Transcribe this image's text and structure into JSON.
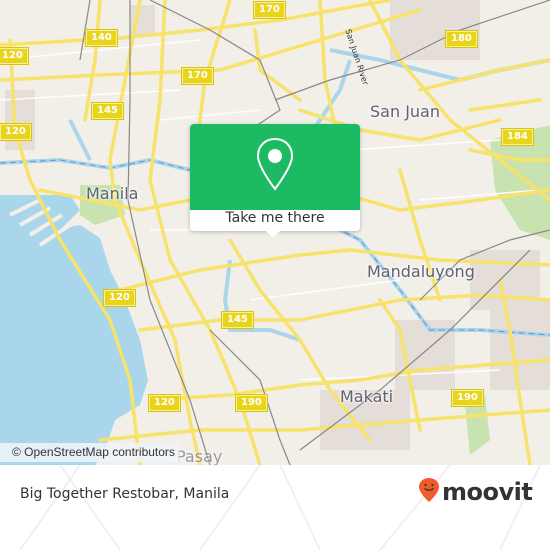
{
  "map": {
    "place_labels": [
      {
        "id": "manila",
        "text": "Manila"
      },
      {
        "id": "san-juan",
        "text": "San Juan"
      },
      {
        "id": "mandaluyong",
        "text": "Mandaluyong"
      },
      {
        "id": "makati",
        "text": "Makati"
      },
      {
        "id": "pasay",
        "text": "Pasay"
      }
    ],
    "river_label": "San Juan River",
    "road_shields": [
      "170",
      "140",
      "120",
      "170",
      "145",
      "180",
      "184",
      "120",
      "145",
      "120",
      "190",
      "190",
      "120"
    ],
    "attribution": "© OpenStreetMap contributors",
    "colors": {
      "water": "#a9d6ea",
      "road": "#f7e26b",
      "land": "#f2efe9",
      "park": "#c8e3b0"
    }
  },
  "popup": {
    "icon": "map-pin-icon",
    "button_label": "Take me there",
    "color": "#1dba64"
  },
  "footer": {
    "place_name": "Big Together Restobar, Manila",
    "brand": "moovit",
    "brand_color": "#f15a2b"
  }
}
